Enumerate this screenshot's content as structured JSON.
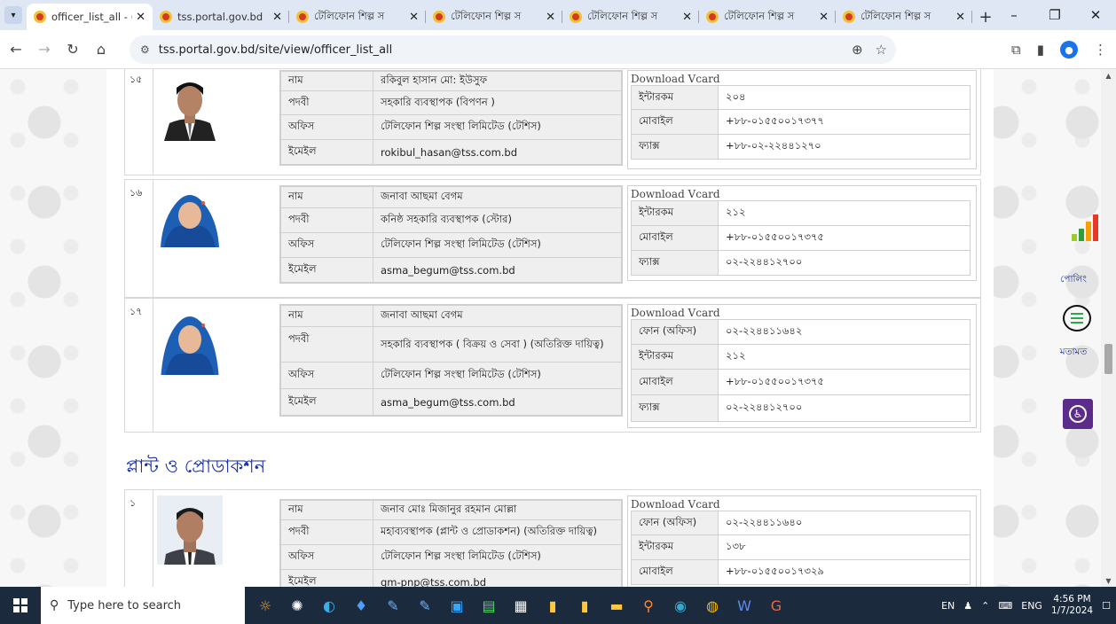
{
  "browser": {
    "tabs": [
      {
        "title": "officer_list_all - (",
        "active": true
      },
      {
        "title": "tss.portal.gov.bd",
        "active": false
      },
      {
        "title": "টেলিফোন শিল্প স",
        "active": false
      },
      {
        "title": "টেলিফোন শিল্প স",
        "active": false
      },
      {
        "title": "টেলিফোন শিল্প স",
        "active": false
      },
      {
        "title": "টেলিফোন শিল্প স",
        "active": false
      },
      {
        "title": "টেলিফোন শিল্প স",
        "active": false
      }
    ],
    "url": "tss.portal.gov.bd/site/view/officer_list_all"
  },
  "labels": {
    "name": "নাম",
    "designation": "পদবী",
    "office": "অফিস",
    "email": "ইমেইল",
    "download_vcard": "Download Vcard",
    "phone_office": "ফোন (অফিস)",
    "intercom": "ইন্টারকম",
    "mobile": "মোবাইল",
    "fax": "ফ্যাক্স"
  },
  "officers": [
    {
      "num": "১৫",
      "name": "রকিবুল হাসান মো: ইউসুফ",
      "designation": "সহকারি ব্যবস্থাপক (বিপণন )",
      "office": "টেলিফোন শিল্প সংস্থা লিমিটেড (টেশিস)",
      "email": "rokibul_hasan@tss.com.bd",
      "intercom": "২০৪",
      "mobile": "+৮৮-০১৫৫০০১৭৩৭৭",
      "fax": "+৮৮-০২-২২৪৪১২৭০"
    },
    {
      "num": "১৬",
      "name": "জনাবা আছমা বেগম",
      "designation": "কনিষ্ঠ সহকারি ব্যবস্থাপক (স্টোর)",
      "office": "টেলিফোন শিল্প সংস্থা লিমিটেড (টেশিস)",
      "email": "asma_begum@tss.com.bd",
      "intercom": "২১২",
      "mobile": "+৮৮-০১৫৫০০১৭৩৭৫",
      "fax": "০২-২২৪৪১২৭০০"
    },
    {
      "num": "১৭",
      "name": "জনাবা আছমা বেগম",
      "designation": "সহকারি ব্যবস্থাপক ( বিক্রয় ও সেবা ) (অতিরিক্ত দায়িত্ব)",
      "office": "টেলিফোন শিল্প সংস্থা লিমিটেড (টেশিস)",
      "email": "asma_begum@tss.com.bd",
      "phone_office": "০২-২২৪৪১১৬৪২",
      "intercom": "২১২",
      "mobile": "+৮৮-০১৫৫০০১৭৩৭৫",
      "fax": "০২-২২৪৪১২৭০০"
    },
    {
      "num": "১",
      "name": "জনাব মোঃ মিজানুর রহমান মোল্লা",
      "designation": "মহাব্যবস্থাপক (প্লান্ট ও প্রোডাকশন) (অতিরিক্ত দায়িত্ব)",
      "office": "টেলিফোন শিল্প সংস্থা লিমিটেড (টেশিস)",
      "email": "gm-pnp@tss.com.bd",
      "phone_office": "০২-২২৪৪১১৬৪০",
      "intercom": "১৩৮",
      "mobile": "+৮৮-০১৫৫০০১৭৩২৯"
    }
  ],
  "section_title": "প্লান্ট ও প্রোডাকশন",
  "side": {
    "polling": "পোলিং",
    "feedback": "মতামত"
  },
  "taskbar": {
    "search_placeholder": "Type here to search",
    "lang": "EN",
    "keyboard": "ENG",
    "time": "4:56 PM",
    "date": "1/7/2024"
  }
}
